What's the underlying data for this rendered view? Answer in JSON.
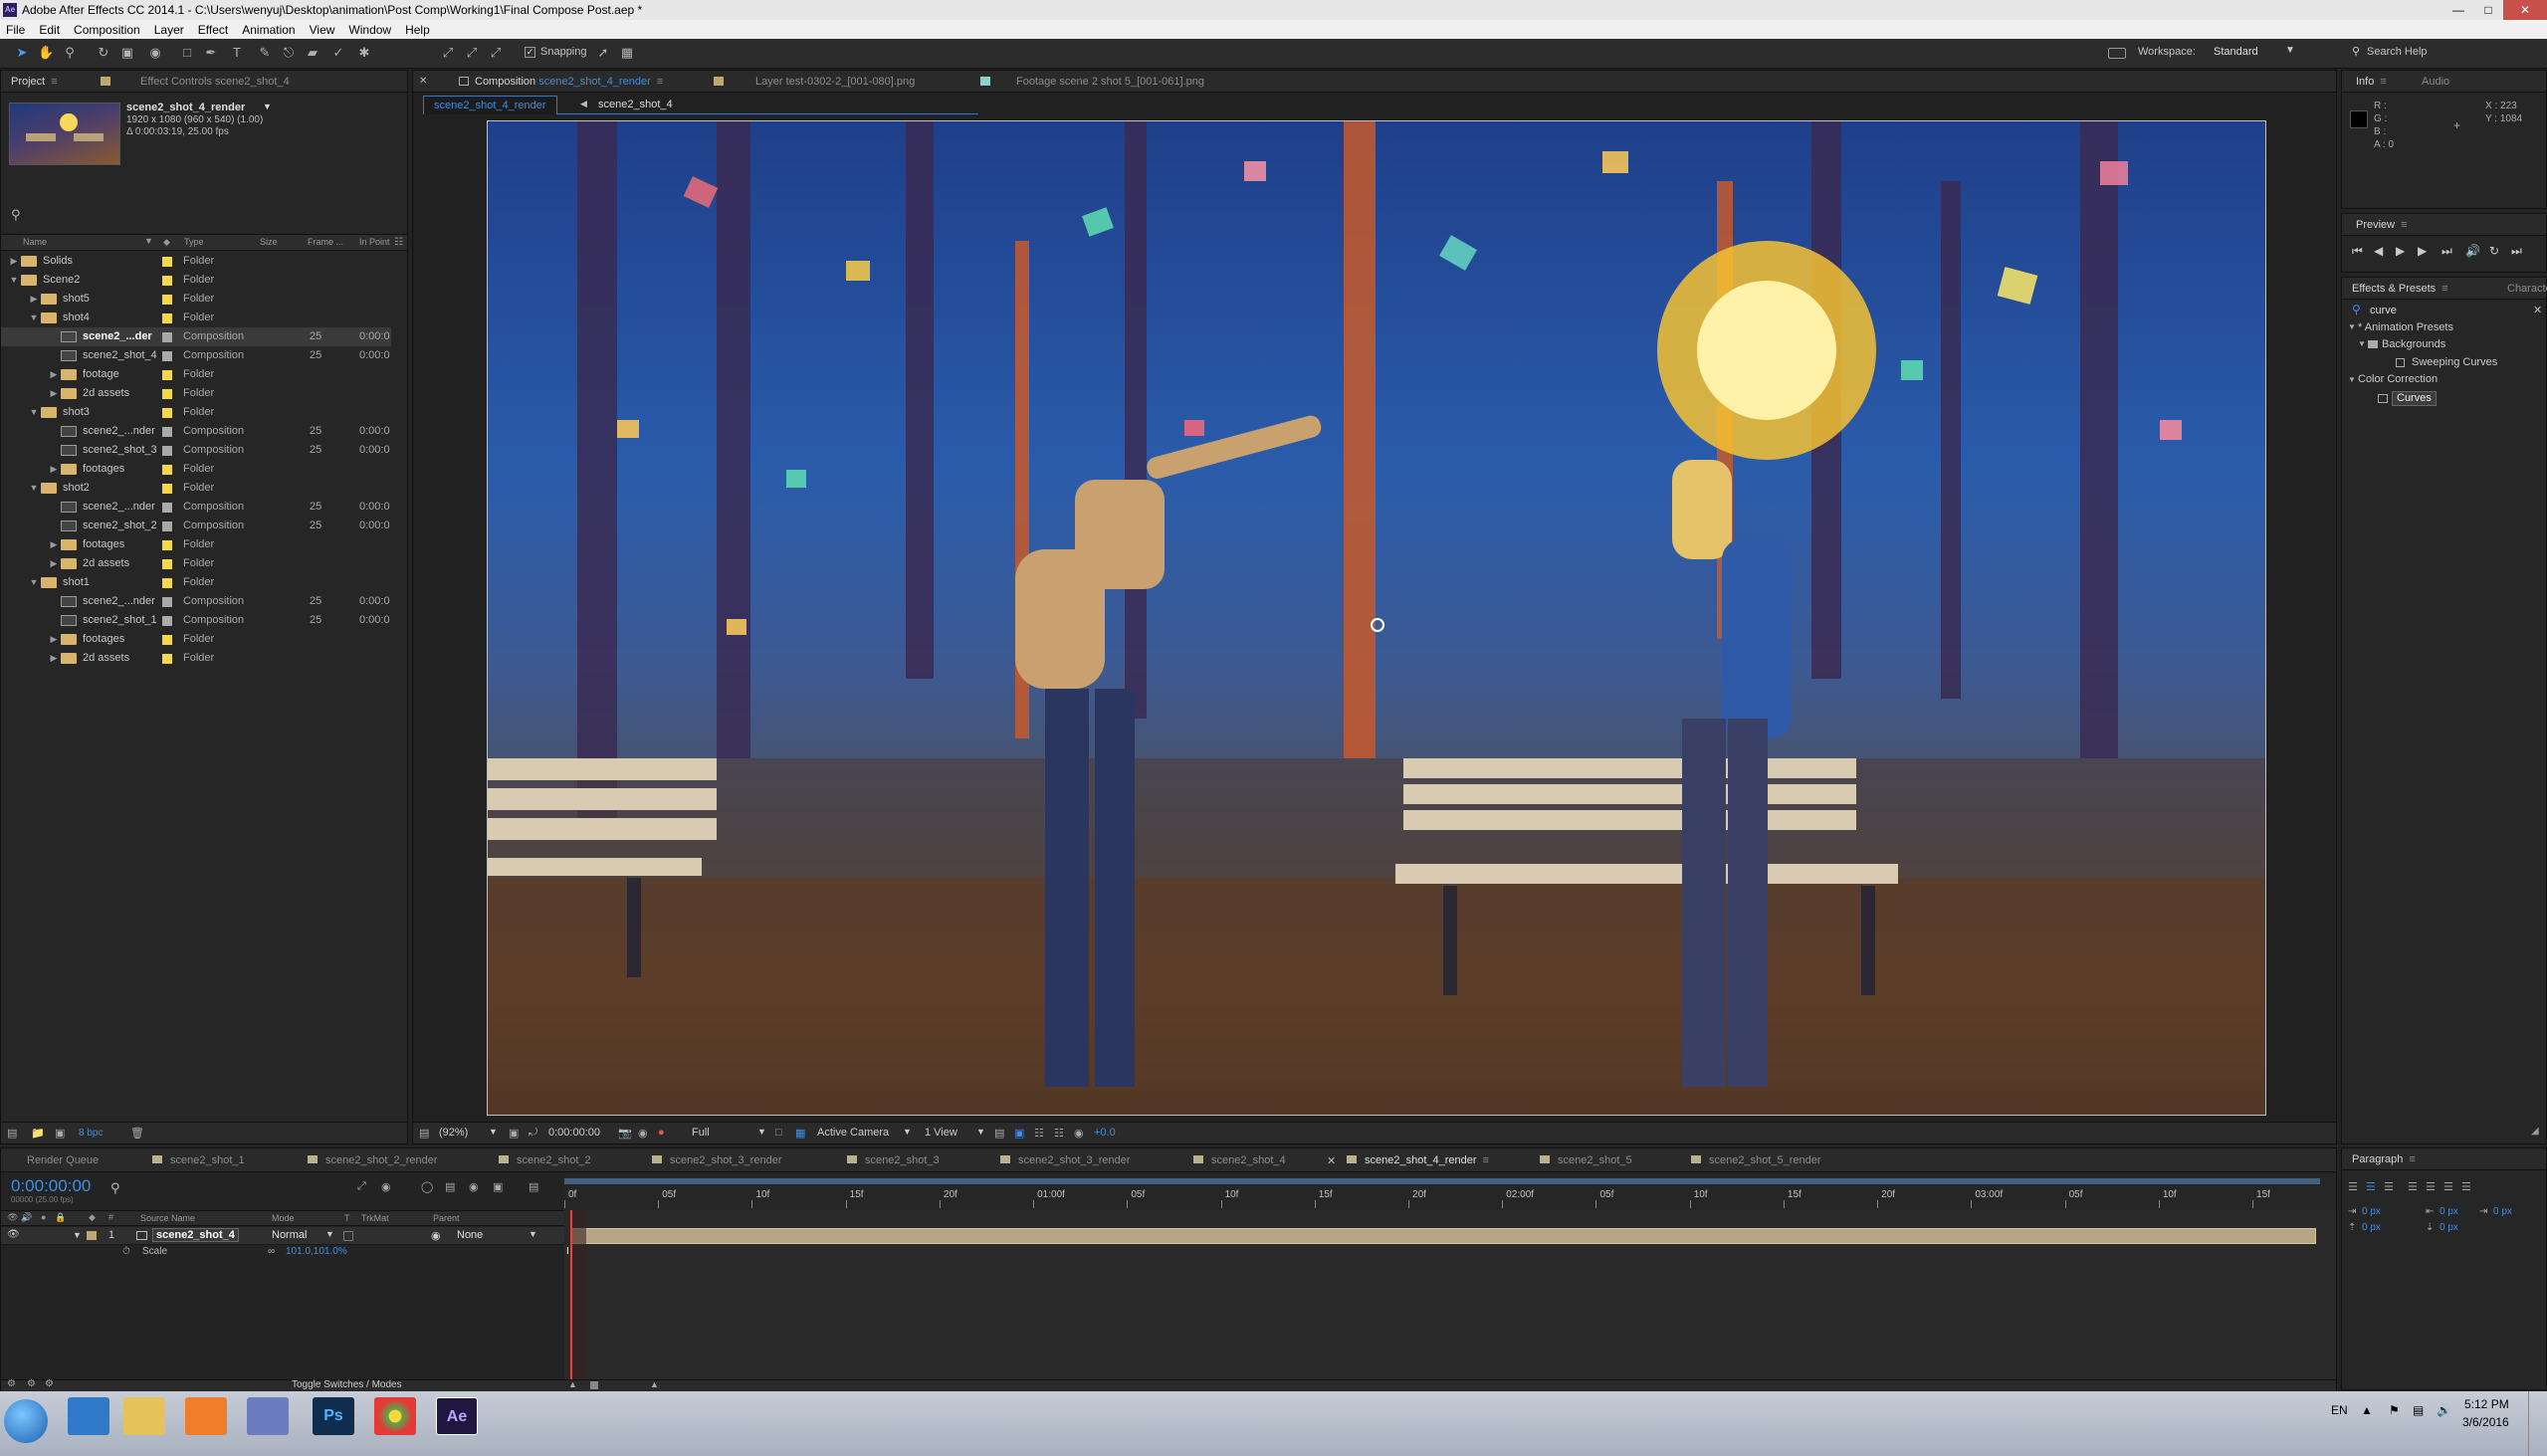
{
  "app": {
    "title": "Adobe After Effects CC 2014.1 - C:\\Users\\wenyuj\\Desktop\\animation\\Post Comp\\Working1\\Final Compose Post.aep *",
    "menu": [
      "File",
      "Edit",
      "Composition",
      "Layer",
      "Effect",
      "Animation",
      "View",
      "Window",
      "Help"
    ]
  },
  "toolbar": {
    "snapping_label": "Snapping",
    "workspace_label": "Workspace:",
    "workspace_value": "Standard",
    "search_help": "Search Help"
  },
  "project": {
    "tab_project": "Project",
    "tab_effect_controls": "Effect Controls scene2_shot_4",
    "thumb_name": "scene2_shot_4_render",
    "thumb_info1": "1920 x 1080  (960 x 540) (1.00)",
    "thumb_info2": "Δ 0:00:03:19, 25.00 fps",
    "columns": [
      "Name",
      "Type",
      "Size",
      "Frame ...",
      "In Point"
    ],
    "rows": [
      {
        "indent": 0,
        "tri": "▶",
        "kind": "folder",
        "name": "Solids",
        "type": "Folder",
        "fr": "",
        "ip": ""
      },
      {
        "indent": 0,
        "tri": "▼",
        "kind": "folder",
        "name": "Scene2",
        "type": "Folder",
        "fr": "",
        "ip": ""
      },
      {
        "indent": 1,
        "tri": "▶",
        "kind": "folder",
        "name": "shot5",
        "type": "Folder",
        "fr": "",
        "ip": ""
      },
      {
        "indent": 1,
        "tri": "▼",
        "kind": "folder",
        "name": "shot4",
        "type": "Folder",
        "fr": "",
        "ip": ""
      },
      {
        "indent": 2,
        "tri": "",
        "kind": "comp",
        "name": "scene2_...der",
        "type": "Composition",
        "fr": "25",
        "ip": "0:00:0",
        "selected": true
      },
      {
        "indent": 2,
        "tri": "",
        "kind": "comp",
        "name": "scene2_shot_4",
        "type": "Composition",
        "fr": "25",
        "ip": "0:00:0"
      },
      {
        "indent": 2,
        "tri": "▶",
        "kind": "folder",
        "name": "footage",
        "type": "Folder",
        "fr": "",
        "ip": ""
      },
      {
        "indent": 2,
        "tri": "▶",
        "kind": "folder",
        "name": "2d assets",
        "type": "Folder",
        "fr": "",
        "ip": ""
      },
      {
        "indent": 1,
        "tri": "▼",
        "kind": "folder",
        "name": "shot3",
        "type": "Folder",
        "fr": "",
        "ip": ""
      },
      {
        "indent": 2,
        "tri": "",
        "kind": "comp",
        "name": "scene2_...nder",
        "type": "Composition",
        "fr": "25",
        "ip": "0:00:0"
      },
      {
        "indent": 2,
        "tri": "",
        "kind": "comp",
        "name": "scene2_shot_3",
        "type": "Composition",
        "fr": "25",
        "ip": "0:00:0"
      },
      {
        "indent": 2,
        "tri": "▶",
        "kind": "folder",
        "name": "footages",
        "type": "Folder",
        "fr": "",
        "ip": ""
      },
      {
        "indent": 1,
        "tri": "▼",
        "kind": "folder",
        "name": "shot2",
        "type": "Folder",
        "fr": "",
        "ip": ""
      },
      {
        "indent": 2,
        "tri": "",
        "kind": "comp",
        "name": "scene2_...nder",
        "type": "Composition",
        "fr": "25",
        "ip": "0:00:0"
      },
      {
        "indent": 2,
        "tri": "",
        "kind": "comp",
        "name": "scene2_shot_2",
        "type": "Composition",
        "fr": "25",
        "ip": "0:00:0"
      },
      {
        "indent": 2,
        "tri": "▶",
        "kind": "folder",
        "name": "footages",
        "type": "Folder",
        "fr": "",
        "ip": ""
      },
      {
        "indent": 2,
        "tri": "▶",
        "kind": "folder",
        "name": "2d assets",
        "type": "Folder",
        "fr": "",
        "ip": ""
      },
      {
        "indent": 1,
        "tri": "▼",
        "kind": "folder",
        "name": "shot1",
        "type": "Folder",
        "fr": "",
        "ip": ""
      },
      {
        "indent": 2,
        "tri": "",
        "kind": "comp",
        "name": "scene2_...nder",
        "type": "Composition",
        "fr": "25",
        "ip": "0:00:0"
      },
      {
        "indent": 2,
        "tri": "",
        "kind": "comp",
        "name": "scene2_shot_1",
        "type": "Composition",
        "fr": "25",
        "ip": "0:00:0"
      },
      {
        "indent": 2,
        "tri": "▶",
        "kind": "folder",
        "name": "footages",
        "type": "Folder",
        "fr": "",
        "ip": ""
      },
      {
        "indent": 2,
        "tri": "▶",
        "kind": "folder",
        "name": "2d assets",
        "type": "Folder",
        "fr": "",
        "ip": ""
      }
    ],
    "bpc": "8 bpc"
  },
  "viewer": {
    "tab_comp_prefix": "Composition",
    "tab_comp_name": "scene2_shot_4_render",
    "tab_layer": "Layer  test-0302-2_[001-080].png",
    "tab_footage": "Footage  scene 2 shot 5_[001-061].png",
    "breadcrumb1": "scene2_shot_4_render",
    "breadcrumb2": "scene2_shot_4",
    "zoom": "(92%)",
    "time": "0:00:00:00",
    "resolution": "Full",
    "camera": "Active Camera",
    "views": "1 View",
    "exposure": "+0.0"
  },
  "info": {
    "tab_info": "Info",
    "tab_audio": "Audio",
    "r": "R :",
    "g": "G :",
    "b": "B :",
    "a": "A : 0",
    "x": "X : 223",
    "y": "Y : 1084"
  },
  "preview": {
    "tab": "Preview"
  },
  "effects": {
    "tab": "Effects & Presets",
    "tab2": "Character",
    "search": "curve",
    "items": [
      "* Animation Presets",
      "Backgrounds",
      "Sweeping Curves",
      "Color Correction",
      "Curves"
    ]
  },
  "paragraph": {
    "tab": "Paragraph",
    "v1": "0 px",
    "v2": "0 px",
    "v3": "0 px",
    "v4": "0 px",
    "v5": "0 px"
  },
  "timeline": {
    "tabs": [
      "Render Queue",
      "scene2_shot_1",
      "scene2_shot_2_render",
      "scene2_shot_2",
      "scene2_shot_3_render",
      "scene2_shot_3",
      "scene2_shot_3_render",
      "scene2_shot_4",
      "scene2_shot_4_render",
      "scene2_shot_5",
      "scene2_shot_5_render"
    ],
    "active_tab": "scene2_shot_4_render",
    "timecode": "0:00:00:00",
    "fps": "00000 (25.00 fps)",
    "col_source": "Source Name",
    "col_mode": "Mode",
    "col_t": "T",
    "col_trkmat": "TrkMat",
    "col_parent": "Parent",
    "layer_num": "1",
    "layer_name": "scene2_shot_4",
    "layer_mode": "Normal",
    "layer_parent": "None",
    "prop_name": "Scale",
    "prop_value": "101.0,101.0%",
    "ruler": [
      "0f",
      "05f",
      "10f",
      "15f",
      "20f",
      "01:00f",
      "05f",
      "10f",
      "15f",
      "20f",
      "02:00f",
      "05f",
      "10f",
      "15f",
      "20f",
      "03:00f",
      "05f",
      "10f",
      "15f"
    ],
    "toggle_label": "Toggle Switches / Modes"
  },
  "taskbar": {
    "lang": "EN",
    "time": "5:12 PM",
    "date": "3/6/2016"
  },
  "colors": {
    "accent_blue": "#2f7ad8",
    "timecode_blue": "#3d8ee6",
    "folder_yellow": "#f3d94a",
    "layer_bar": "#b7a583"
  }
}
